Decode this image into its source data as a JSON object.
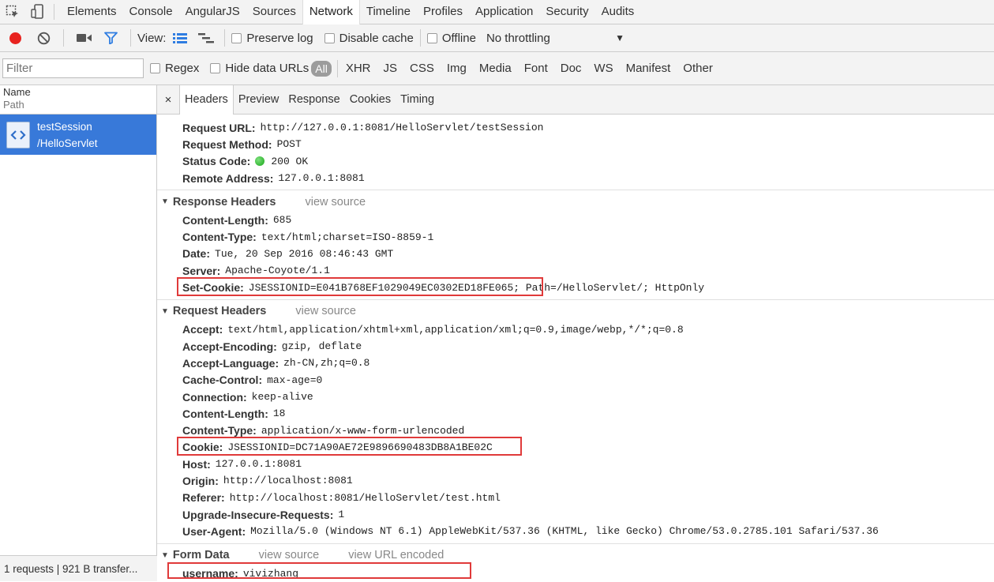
{
  "tabbar": {
    "tabs": [
      "Elements",
      "Console",
      "AngularJS",
      "Sources",
      "Network",
      "Timeline",
      "Profiles",
      "Application",
      "Security",
      "Audits"
    ],
    "active": "Network"
  },
  "toolbar": {
    "view_label": "View:",
    "preserve_log": "Preserve log",
    "disable_cache": "Disable cache",
    "offline": "Offline",
    "throttling": "No throttling"
  },
  "filterbar": {
    "placeholder": "Filter",
    "regex": "Regex",
    "hide_data_urls": "Hide data URLs",
    "types": [
      "All",
      "XHR",
      "JS",
      "CSS",
      "Img",
      "Media",
      "Font",
      "Doc",
      "WS",
      "Manifest",
      "Other"
    ]
  },
  "left": {
    "header_name": "Name",
    "header_path": "Path",
    "request_line1": "testSession",
    "request_line2": "/HelloServlet",
    "status": "1 requests | 921 B transfer..."
  },
  "detail": {
    "tabs": [
      "Headers",
      "Preview",
      "Response",
      "Cookies",
      "Timing"
    ],
    "close": "×",
    "general": [
      {
        "k": "Request URL:",
        "v": "http://127.0.0.1:8081/HelloServlet/testSession"
      },
      {
        "k": "Request Method:",
        "v": "POST"
      },
      {
        "k": "Status Code:",
        "v": "200 OK"
      },
      {
        "k": "Remote Address:",
        "v": "127.0.0.1:8081"
      }
    ],
    "response_headers_title": "Response Headers",
    "view_source": "view source",
    "response_headers": [
      {
        "k": "Content-Length:",
        "v": "685"
      },
      {
        "k": "Content-Type:",
        "v": "text/html;charset=ISO-8859-1"
      },
      {
        "k": "Date:",
        "v": "Tue, 20 Sep 2016 08:46:43 GMT"
      },
      {
        "k": "Server:",
        "v": "Apache-Coyote/1.1"
      },
      {
        "k": "Set-Cookie:",
        "v": "JSESSIONID=E041B768EF1029049EC0302ED18FE065; Path=/HelloServlet/; HttpOnly"
      }
    ],
    "request_headers_title": "Request Headers",
    "request_headers": [
      {
        "k": "Accept:",
        "v": "text/html,application/xhtml+xml,application/xml;q=0.9,image/webp,*/*;q=0.8"
      },
      {
        "k": "Accept-Encoding:",
        "v": "gzip, deflate"
      },
      {
        "k": "Accept-Language:",
        "v": "zh-CN,zh;q=0.8"
      },
      {
        "k": "Cache-Control:",
        "v": "max-age=0"
      },
      {
        "k": "Connection:",
        "v": "keep-alive"
      },
      {
        "k": "Content-Length:",
        "v": "18"
      },
      {
        "k": "Content-Type:",
        "v": "application/x-www-form-urlencoded"
      },
      {
        "k": "Cookie:",
        "v": "JSESSIONID=DC71A90AE72E9896690483DB8A1BE02C"
      },
      {
        "k": "Host:",
        "v": "127.0.0.1:8081"
      },
      {
        "k": "Origin:",
        "v": "http://localhost:8081"
      },
      {
        "k": "Referer:",
        "v": "http://localhost:8081/HelloServlet/test.html"
      },
      {
        "k": "Upgrade-Insecure-Requests:",
        "v": "1"
      },
      {
        "k": "User-Agent:",
        "v": "Mozilla/5.0 (Windows NT 6.1) AppleWebKit/537.36 (KHTML, like Gecko) Chrome/53.0.2785.101 Safari/537.36"
      }
    ],
    "form_data_title": "Form Data",
    "view_url_encoded": "view URL encoded",
    "form_data": [
      {
        "k": "username:",
        "v": "vivizhang"
      }
    ]
  },
  "colors": {
    "selected_row": "#3879d9",
    "highlight_box": "#e03a3a",
    "record": "#e8231f",
    "filter_icon": "#2f7de1"
  }
}
